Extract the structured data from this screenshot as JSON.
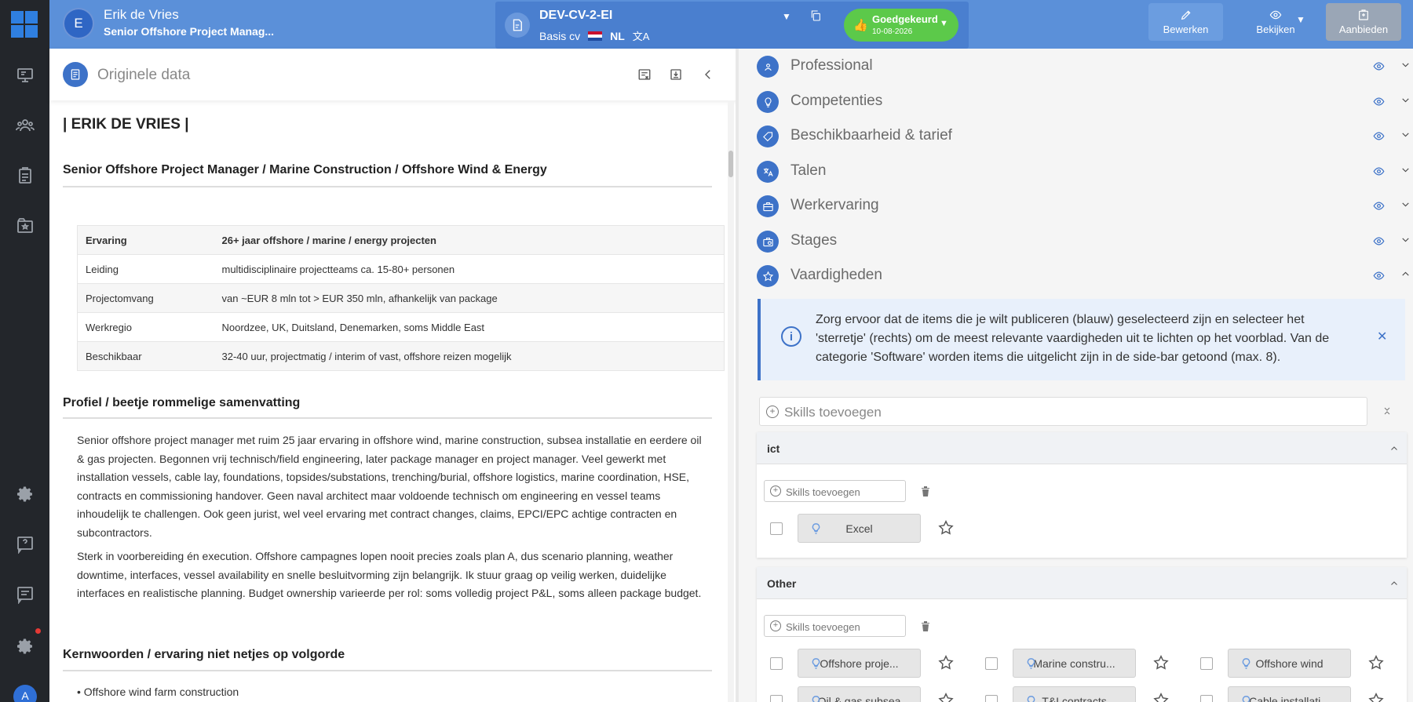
{
  "user": {
    "initial": "E",
    "name": "Erik de Vries",
    "role": "Senior Offshore Project Manag..."
  },
  "cv": {
    "id": "DEV-CV-2-EI",
    "type": "Basis cv",
    "lang": "NL"
  },
  "status": {
    "label": "Goedgekeurd",
    "date": "10-08-2026",
    "color": "#5cc94a"
  },
  "actions": {
    "edit": "Bewerken",
    "view": "Bekijken",
    "offer": "Aanbieden"
  },
  "sidebar": {
    "avatar": "A"
  },
  "left": {
    "title": "Originele data",
    "name": "| ERIK DE VRIES |",
    "headline": "Senior Offshore Project Manager / Marine Construction / Offshore Wind & Energy",
    "table": [
      {
        "k": "Ervaring",
        "v": "26+ jaar offshore / marine / energy projecten"
      },
      {
        "k": "Leiding",
        "v": "multidisciplinaire projectteams ca. 15-80+ personen"
      },
      {
        "k": "Projectomvang",
        "v": "van ~EUR 8 mln tot > EUR 350 mln, afhankelijk van package"
      },
      {
        "k": "Werkregio",
        "v": "Noordzee, UK, Duitsland, Denemarken, soms Middle East"
      },
      {
        "k": "Beschikbaar",
        "v": "32-40 uur, projectmatig / interim of vast, offshore reizen mogelijk"
      }
    ],
    "profile_heading": "Profiel / beetje rommelige samenvatting",
    "profile_p1": "Senior offshore project manager met ruim 25 jaar ervaring in offshore wind, marine construction, subsea installatie en eerdere oil & gas projecten. Begonnen vrij technisch/field engineering, later package manager en project manager. Veel gewerkt met installation vessels, cable lay, foundations, topsides/substations, trenching/burial, offshore logistics, marine coordination, HSE, contracts en commissioning handover. Geen naval architect maar voldoende technisch om engineering en vessel teams inhoudelijk te challengen. Ook geen jurist, wel veel ervaring met contract changes, claims, EPCI/EPC achtige contracten en subcontractors.",
    "profile_p2": "Sterk in voorbereiding én execution. Offshore campagnes lopen nooit precies zoals plan A, dus scenario planning, weather downtime, interfaces, vessel availability en snelle besluitvorming zijn belangrijk. Ik stuur graag op veilig werken, duidelijke interfaces en realistische planning. Budget ownership varieerde per rol: soms volledig project P&L, soms alleen package budget.",
    "keywords_heading": "Kernwoorden / ervaring niet netjes op volgorde",
    "keyword1": "• Offshore wind farm construction"
  },
  "sections": [
    "Professional",
    "Competenties",
    "Beschikbaarheid & tarief",
    "Talen",
    "Werkervaring",
    "Stages",
    "Vaardigheden"
  ],
  "info": "Zorg ervoor dat de items die je wilt publiceren (blauw) geselecteerd zijn en selecteer het 'sterretje' (rechts) om de meest relevante vaardigheden uit te lichten op het voorblad. Van de categorie 'Software' worden items die uitgelicht zijn in de side-bar getoond (max. 8).",
  "skills": {
    "placeholder": "Skills toevoegen",
    "categories": [
      {
        "name": "ict",
        "items": [
          "Excel"
        ]
      },
      {
        "name": "Other",
        "items": [
          "Offshore proje...",
          "Marine constru...",
          "Offshore wind",
          "Oil & gas subsea",
          "T&I contracts",
          "Cable installati..."
        ]
      }
    ]
  }
}
